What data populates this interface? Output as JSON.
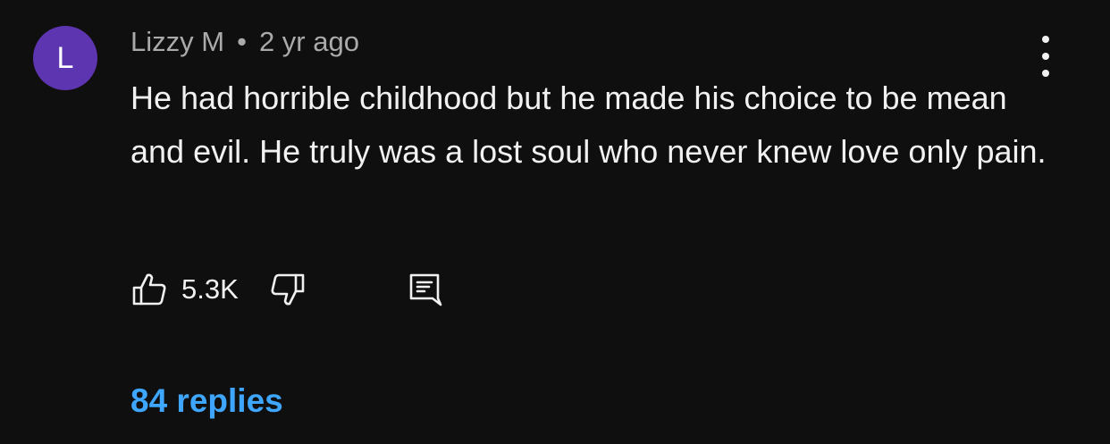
{
  "comment": {
    "avatar_letter": "L",
    "avatar_color": "#5e35b1",
    "author": "Lizzy M",
    "separator": "•",
    "time": "2 yr ago",
    "text": "He had horrible childhood but he made his choice to be mean and evil. He truly was a lost soul who never knew love only pain.",
    "like_count": "5.3K",
    "replies_label": "84 replies",
    "replies_color": "#3ea6ff",
    "icons": {
      "like": "thumbs-up-icon",
      "dislike": "thumbs-down-icon",
      "reply": "reply-comment-icon",
      "menu": "more-vertical-icon"
    }
  }
}
